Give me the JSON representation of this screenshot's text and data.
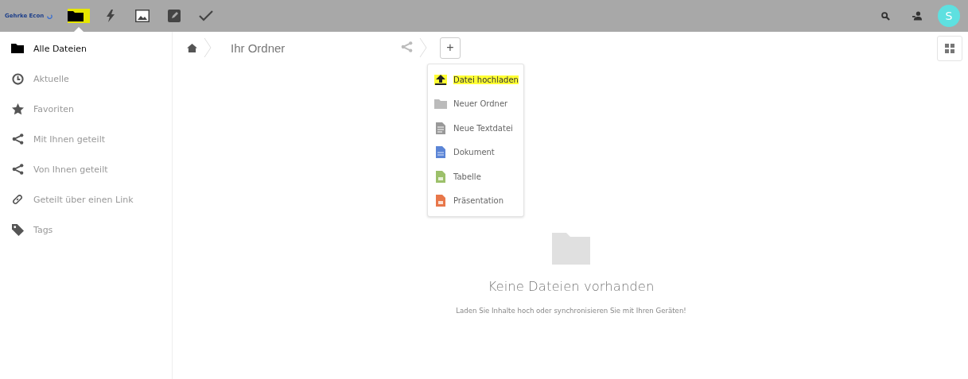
{
  "header": {
    "logo": "Gehrke Econ",
    "apps": [
      {
        "kind": "files",
        "selected": true,
        "highlighted": true
      },
      {
        "kind": "activity",
        "selected": false,
        "highlighted": false
      },
      {
        "kind": "gallery",
        "selected": false,
        "highlighted": false
      },
      {
        "kind": "notes",
        "selected": false,
        "highlighted": false
      },
      {
        "kind": "tasks",
        "selected": false,
        "highlighted": false
      }
    ],
    "avatar": "S"
  },
  "sidebar": {
    "items": [
      {
        "label": "Alle Dateien",
        "kind": "folder",
        "selected": true
      },
      {
        "label": "Aktuelle",
        "kind": "clock",
        "selected": false
      },
      {
        "label": "Favoriten",
        "kind": "star",
        "selected": false
      },
      {
        "label": "Mit Ihnen geteilt",
        "kind": "share",
        "selected": false
      },
      {
        "label": "Von Ihnen geteilt",
        "kind": "share",
        "selected": false
      },
      {
        "label": "Geteilt über einen Link",
        "kind": "link",
        "selected": false
      },
      {
        "label": "Tags",
        "kind": "tag",
        "selected": false
      }
    ]
  },
  "breadcrumb": {
    "folder": "Ihr Ordner",
    "new_button": "+"
  },
  "new_menu": {
    "items": [
      {
        "label": "Datei hochladen",
        "kind": "upload",
        "highlighted": true
      },
      {
        "label": "Neuer Ordner",
        "kind": "folder",
        "highlighted": false
      },
      {
        "label": "Neue Textdatei",
        "kind": "text",
        "highlighted": false
      },
      {
        "label": "Dokument",
        "kind": "document",
        "highlighted": false
      },
      {
        "label": "Tabelle",
        "kind": "spreadsheet",
        "highlighted": false
      },
      {
        "label": "Präsentation",
        "kind": "presentation",
        "highlighted": false
      }
    ]
  },
  "empty": {
    "title": "Keine Dateien vorhanden",
    "message": "Laden Sie Inhalte hoch oder synchronisieren Sie mit Ihren Geräten!"
  }
}
